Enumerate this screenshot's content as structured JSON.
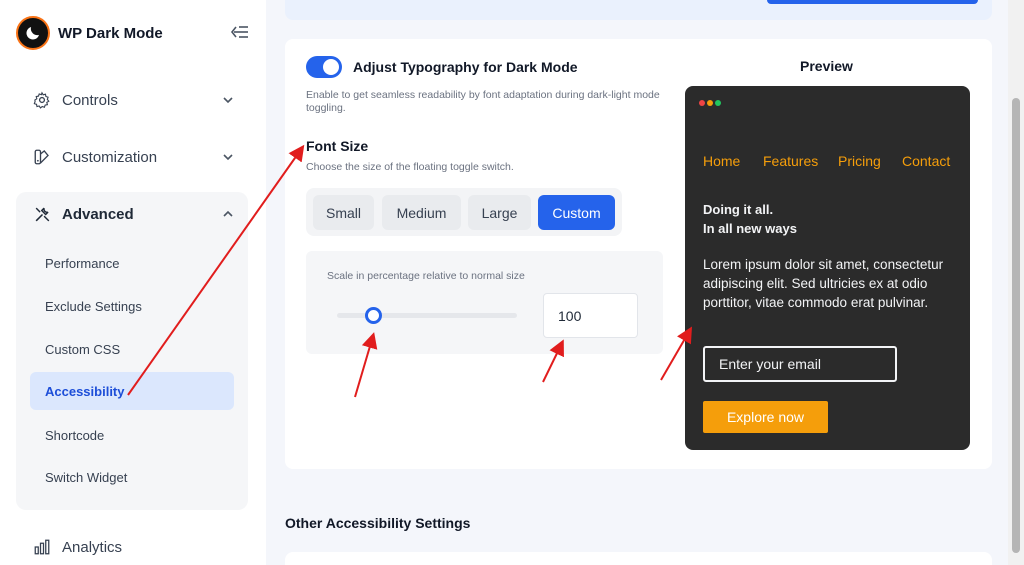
{
  "brand": {
    "title": "WP Dark Mode"
  },
  "sidebar": {
    "items": [
      {
        "label": "Controls"
      },
      {
        "label": "Customization"
      },
      {
        "label": "Advanced"
      },
      {
        "label": "Analytics"
      }
    ],
    "advanced_sub": [
      {
        "label": "Performance"
      },
      {
        "label": "Exclude Settings"
      },
      {
        "label": "Custom CSS"
      },
      {
        "label": "Accessibility"
      },
      {
        "label": "Shortcode"
      },
      {
        "label": "Switch Widget"
      }
    ]
  },
  "typography": {
    "toggle_title": "Adjust Typography for Dark Mode",
    "toggle_desc": "Enable to get seamless readability by font adaptation during dark-light mode toggling.",
    "toggle_on": true
  },
  "font_size": {
    "title": "Font Size",
    "desc": "Choose the size of the floating toggle switch.",
    "options": [
      "Small",
      "Medium",
      "Large",
      "Custom"
    ],
    "selected": "Custom",
    "scale_label": "Scale in percentage relative to normal size",
    "scale_value": "100",
    "slider_fraction": 0.2
  },
  "preview": {
    "title": "Preview",
    "nav": [
      "Home",
      "Features",
      "Pricing",
      "Contact"
    ],
    "heading_line1": "Doing it all.",
    "heading_line2": "In all new ways",
    "body": "Lorem ipsum dolor sit amet, consectetur adipiscing elit. Sed ultricies ex at odio porttitor, vitae commodo erat pulvinar.",
    "email_placeholder": "Enter your email",
    "button": "Explore now",
    "dot_colors": [
      "#ef4444",
      "#f59e0b",
      "#22c55e"
    ]
  },
  "other": {
    "title": "Other Accessibility Settings"
  },
  "colors": {
    "accent": "#2563eb",
    "preview_accent": "#f59e0b",
    "annotation": "#e11d1d"
  }
}
